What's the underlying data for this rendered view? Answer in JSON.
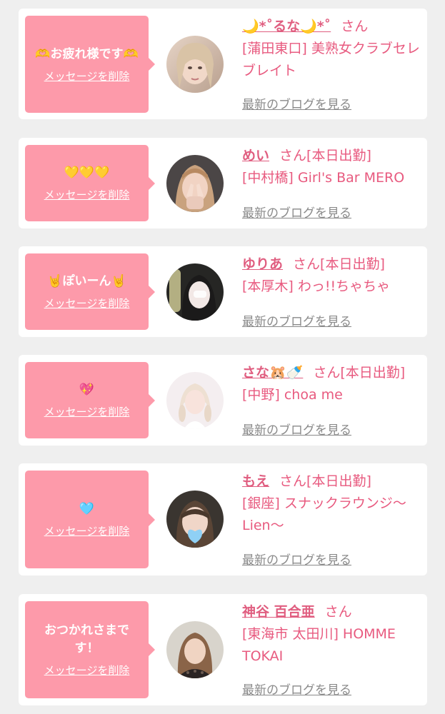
{
  "delete_label": "メッセージを削除",
  "blog_label": "最新のブログを見る",
  "honorific": "さん",
  "colors": {
    "bubble": "#fd9aaa",
    "accent": "#e85a7f",
    "link_gray": "#8a8a8a"
  },
  "cards": [
    {
      "message": "🫶お疲れ様です🫶",
      "name": "🌙*˚るな🌙*˚",
      "status": "",
      "shop": "[蒲田東口] 美熟女クラブセレブレイト",
      "avatar_icon": "avatar-blonde-woman-photo"
    },
    {
      "message": "💛💛💛",
      "name": "めい",
      "status": "[本日出勤]",
      "shop": "[中村橋] Girl's Bar MERO",
      "avatar_icon": "avatar-woman-peace-sign-photo"
    },
    {
      "message": "🤘ぽいーん🤘",
      "name": "ゆりあ",
      "status": "[本日出勤]",
      "shop": "[本厚木] わっ!!ちゃちゃ",
      "avatar_icon": "avatar-woman-dark-hair-photo"
    },
    {
      "message": "💖",
      "name": "さな🐹🍼",
      "status": "[本日出勤]",
      "shop": "[中野] choa me",
      "avatar_icon": "avatar-woman-white-dress-photo"
    },
    {
      "message": "🩵",
      "name": "もえ",
      "status": "[本日出勤]",
      "shop": "[銀座] スナックラウンジ〜Lien〜",
      "avatar_icon": "avatar-woman-blue-heart-photo"
    },
    {
      "message": "おつかれさまです！",
      "name": "神谷 百合亜",
      "status": "",
      "shop": "[東海市 太田川] HOMME TOKAI",
      "avatar_icon": "avatar-woman-lace-dress-photo"
    }
  ]
}
